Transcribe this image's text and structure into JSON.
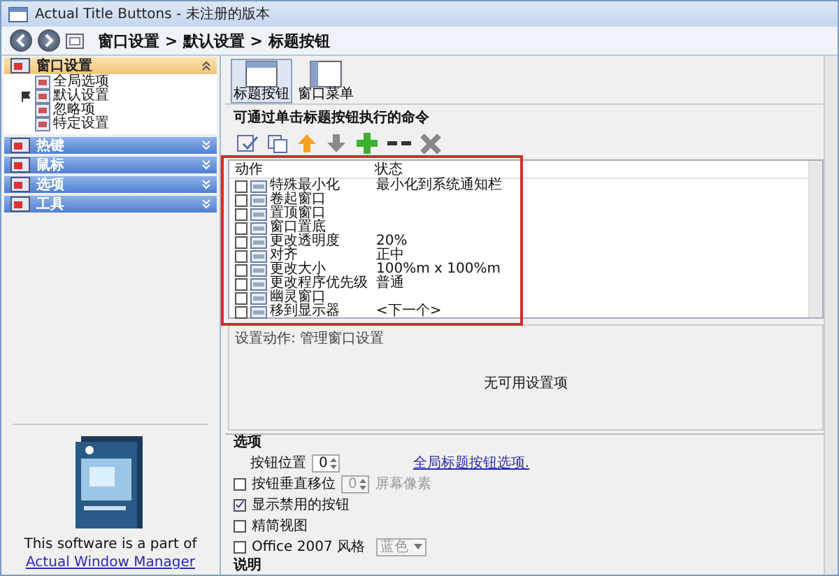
{
  "window": {
    "title": "Actual Title Buttons - 未注册的版本"
  },
  "breadcrumb": "窗口设置 > 默认设置 > 标题按钮",
  "sidebar": {
    "sections": [
      {
        "label": "窗口设置",
        "expanded": true,
        "children": [
          {
            "label": "全局选项",
            "checked": false
          },
          {
            "label": "默认设置",
            "checked": true
          },
          {
            "label": "忽略项",
            "checked": false
          },
          {
            "label": "特定设置",
            "checked": false
          }
        ]
      },
      {
        "label": "热键",
        "expanded": false
      },
      {
        "label": "鼠标",
        "expanded": false
      },
      {
        "label": "选项",
        "expanded": false
      },
      {
        "label": "工具",
        "expanded": false
      }
    ],
    "promo_text": "This software is a part of",
    "promo_link": "Actual Window Manager"
  },
  "tabs": [
    {
      "label": "标题按钮",
      "selected": true
    },
    {
      "label": "窗口菜单",
      "selected": false
    }
  ],
  "commands": {
    "heading": "可通过单击标题按钮执行的命令",
    "columns": [
      "动作",
      "状态"
    ],
    "rows": [
      {
        "action": "特殊最小化",
        "state": "最小化到系统通知栏",
        "checked": false
      },
      {
        "action": "卷起窗口",
        "state": "",
        "checked": false
      },
      {
        "action": "置顶窗口",
        "state": "",
        "checked": false
      },
      {
        "action": "窗口置底",
        "state": "",
        "checked": false
      },
      {
        "action": "更改透明度",
        "state": "20%",
        "checked": false
      },
      {
        "action": "对齐",
        "state": "正中",
        "checked": false
      },
      {
        "action": "更改大小",
        "state": "100%m x 100%m",
        "checked": false
      },
      {
        "action": "更改程序优先级",
        "state": "普通",
        "checked": false
      },
      {
        "action": "幽灵窗口",
        "state": "",
        "checked": false
      },
      {
        "action": "移到显示器",
        "state": "<下一个>",
        "checked": false
      }
    ]
  },
  "settings": {
    "label": "设置动作: 管理窗口设置",
    "empty_text": "无可用设置项"
  },
  "options": {
    "heading": "选项",
    "button_position": {
      "label": "按钮位置",
      "value": "0",
      "link": "全局标题按钮选项."
    },
    "items": [
      {
        "kind": "spinner",
        "label": "按钮垂直移位",
        "checked": false,
        "value": "0",
        "unit": "屏幕像素"
      },
      {
        "kind": "check",
        "label": "显示禁用的按钮",
        "checked": true
      },
      {
        "kind": "check",
        "label": "精简视图",
        "checked": false
      },
      {
        "kind": "select",
        "label": "Office 2007 风格",
        "checked": false,
        "value": "蓝色"
      }
    ]
  },
  "description": {
    "heading": "说明"
  }
}
